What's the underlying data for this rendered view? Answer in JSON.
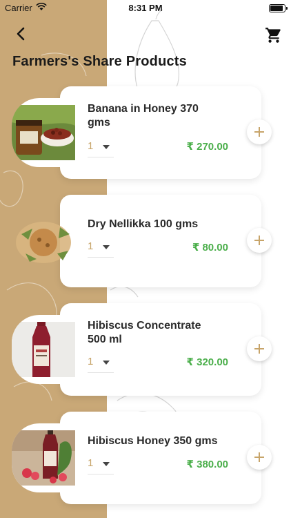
{
  "status_bar": {
    "carrier": "Carrier",
    "time": "8:31 PM"
  },
  "header": {
    "title": "Farmers's Share Products",
    "back_icon": "chevron-left-icon",
    "cart_icon": "cart-icon"
  },
  "colors": {
    "accent": "#c7a469",
    "price": "#4aae4a",
    "left_panel": "#c9a877"
  },
  "products": [
    {
      "name_line1": "Banana in Honey 370",
      "name_line2": "gms",
      "qty": "1",
      "price": "₹ 270.00"
    },
    {
      "name_line1": "Dry Nellikka 100 gms",
      "name_line2": "",
      "qty": "1",
      "price": "₹ 80.00"
    },
    {
      "name_line1": "Hibiscus Concentrate",
      "name_line2": "500 ml",
      "qty": "1",
      "price": "₹ 320.00"
    },
    {
      "name_line1": "Hibiscus Honey 350 gms",
      "name_line2": "",
      "qty": "1",
      "price": "₹ 380.00"
    }
  ]
}
